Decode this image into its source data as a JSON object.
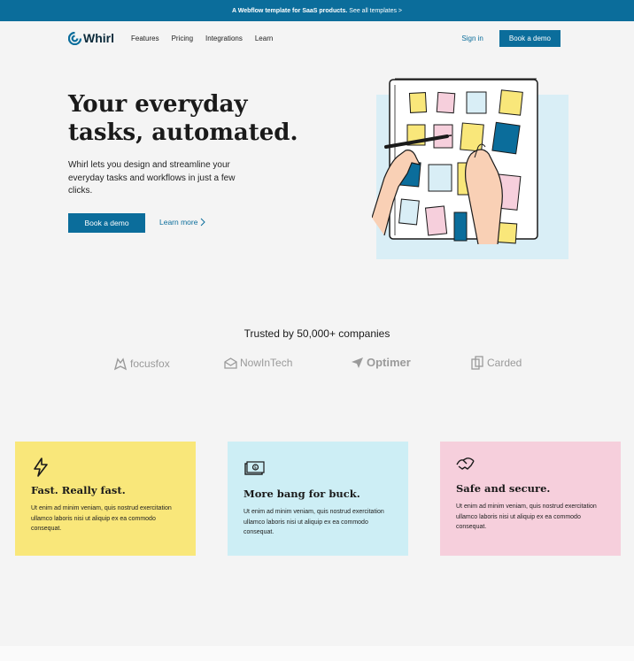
{
  "topbar": {
    "text": "A Webflow template for SaaS products.",
    "link": "See all templates >"
  },
  "nav": {
    "logo": "Whirl",
    "links": [
      "Features",
      "Pricing",
      "Integrations",
      "Learn"
    ],
    "signin": "Sign in",
    "cta": "Book a demo"
  },
  "hero": {
    "title_line1": "Your everyday",
    "title_line2": "tasks, automated.",
    "subtitle": "Whirl lets you design and streamline your everyday tasks and workflows in just a few clicks.",
    "cta": "Book a demo",
    "learn": "Learn more"
  },
  "trusted": {
    "title": "Trusted by 50,000+ companies",
    "companies": [
      "focusfox",
      "NowInTech",
      "Optimer",
      "Carded"
    ]
  },
  "features": [
    {
      "title": "Fast. Really fast.",
      "body": "Ut enim ad minim veniam, quis nostrud exercitation ullamco laboris nisi ut aliquip ex ea commodo consequat.",
      "icon": "lightning-icon",
      "color": "#f9e77a"
    },
    {
      "title": "More bang for buck.",
      "body": "Ut enim ad minim veniam, quis nostrud exercitation ullamco laboris nisi ut aliquip ex ea commodo consequat.",
      "icon": "money-icon",
      "color": "#cdeef5"
    },
    {
      "title": "Safe and secure.",
      "body": "Ut enim ad minim veniam, quis nostrud exercitation ullamco laboris nisi ut aliquip ex ea commodo consequat.",
      "icon": "handshake-icon",
      "color": "#f6cfdc"
    }
  ],
  "colors": {
    "brand": "#0b6d9b",
    "yellow": "#f9e77a",
    "lightblue": "#cdeef5",
    "pink": "#f6cfdc"
  }
}
